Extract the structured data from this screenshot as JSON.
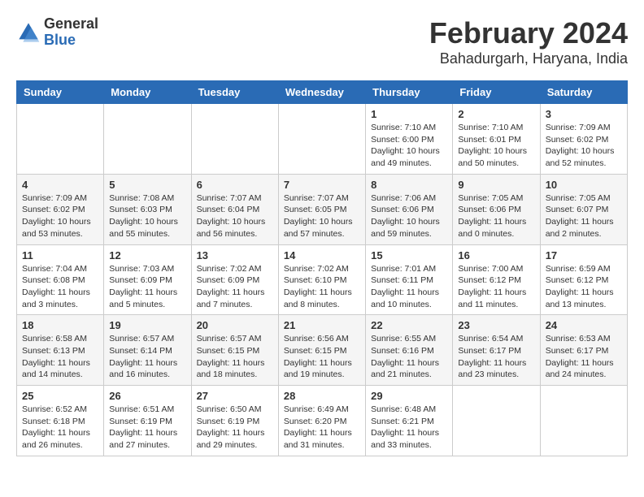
{
  "header": {
    "logo": {
      "line1": "General",
      "line2": "Blue"
    },
    "title": "February 2024",
    "location": "Bahadurgarh, Haryana, India"
  },
  "weekdays": [
    "Sunday",
    "Monday",
    "Tuesday",
    "Wednesday",
    "Thursday",
    "Friday",
    "Saturday"
  ],
  "weeks": [
    [
      {
        "day": "",
        "info": ""
      },
      {
        "day": "",
        "info": ""
      },
      {
        "day": "",
        "info": ""
      },
      {
        "day": "",
        "info": ""
      },
      {
        "day": "1",
        "info": "Sunrise: 7:10 AM\nSunset: 6:00 PM\nDaylight: 10 hours\nand 49 minutes."
      },
      {
        "day": "2",
        "info": "Sunrise: 7:10 AM\nSunset: 6:01 PM\nDaylight: 10 hours\nand 50 minutes."
      },
      {
        "day": "3",
        "info": "Sunrise: 7:09 AM\nSunset: 6:02 PM\nDaylight: 10 hours\nand 52 minutes."
      }
    ],
    [
      {
        "day": "4",
        "info": "Sunrise: 7:09 AM\nSunset: 6:02 PM\nDaylight: 10 hours\nand 53 minutes."
      },
      {
        "day": "5",
        "info": "Sunrise: 7:08 AM\nSunset: 6:03 PM\nDaylight: 10 hours\nand 55 minutes."
      },
      {
        "day": "6",
        "info": "Sunrise: 7:07 AM\nSunset: 6:04 PM\nDaylight: 10 hours\nand 56 minutes."
      },
      {
        "day": "7",
        "info": "Sunrise: 7:07 AM\nSunset: 6:05 PM\nDaylight: 10 hours\nand 57 minutes."
      },
      {
        "day": "8",
        "info": "Sunrise: 7:06 AM\nSunset: 6:06 PM\nDaylight: 10 hours\nand 59 minutes."
      },
      {
        "day": "9",
        "info": "Sunrise: 7:05 AM\nSunset: 6:06 PM\nDaylight: 11 hours\nand 0 minutes."
      },
      {
        "day": "10",
        "info": "Sunrise: 7:05 AM\nSunset: 6:07 PM\nDaylight: 11 hours\nand 2 minutes."
      }
    ],
    [
      {
        "day": "11",
        "info": "Sunrise: 7:04 AM\nSunset: 6:08 PM\nDaylight: 11 hours\nand 3 minutes."
      },
      {
        "day": "12",
        "info": "Sunrise: 7:03 AM\nSunset: 6:09 PM\nDaylight: 11 hours\nand 5 minutes."
      },
      {
        "day": "13",
        "info": "Sunrise: 7:02 AM\nSunset: 6:09 PM\nDaylight: 11 hours\nand 7 minutes."
      },
      {
        "day": "14",
        "info": "Sunrise: 7:02 AM\nSunset: 6:10 PM\nDaylight: 11 hours\nand 8 minutes."
      },
      {
        "day": "15",
        "info": "Sunrise: 7:01 AM\nSunset: 6:11 PM\nDaylight: 11 hours\nand 10 minutes."
      },
      {
        "day": "16",
        "info": "Sunrise: 7:00 AM\nSunset: 6:12 PM\nDaylight: 11 hours\nand 11 minutes."
      },
      {
        "day": "17",
        "info": "Sunrise: 6:59 AM\nSunset: 6:12 PM\nDaylight: 11 hours\nand 13 minutes."
      }
    ],
    [
      {
        "day": "18",
        "info": "Sunrise: 6:58 AM\nSunset: 6:13 PM\nDaylight: 11 hours\nand 14 minutes."
      },
      {
        "day": "19",
        "info": "Sunrise: 6:57 AM\nSunset: 6:14 PM\nDaylight: 11 hours\nand 16 minutes."
      },
      {
        "day": "20",
        "info": "Sunrise: 6:57 AM\nSunset: 6:15 PM\nDaylight: 11 hours\nand 18 minutes."
      },
      {
        "day": "21",
        "info": "Sunrise: 6:56 AM\nSunset: 6:15 PM\nDaylight: 11 hours\nand 19 minutes."
      },
      {
        "day": "22",
        "info": "Sunrise: 6:55 AM\nSunset: 6:16 PM\nDaylight: 11 hours\nand 21 minutes."
      },
      {
        "day": "23",
        "info": "Sunrise: 6:54 AM\nSunset: 6:17 PM\nDaylight: 11 hours\nand 23 minutes."
      },
      {
        "day": "24",
        "info": "Sunrise: 6:53 AM\nSunset: 6:17 PM\nDaylight: 11 hours\nand 24 minutes."
      }
    ],
    [
      {
        "day": "25",
        "info": "Sunrise: 6:52 AM\nSunset: 6:18 PM\nDaylight: 11 hours\nand 26 minutes."
      },
      {
        "day": "26",
        "info": "Sunrise: 6:51 AM\nSunset: 6:19 PM\nDaylight: 11 hours\nand 27 minutes."
      },
      {
        "day": "27",
        "info": "Sunrise: 6:50 AM\nSunset: 6:19 PM\nDaylight: 11 hours\nand 29 minutes."
      },
      {
        "day": "28",
        "info": "Sunrise: 6:49 AM\nSunset: 6:20 PM\nDaylight: 11 hours\nand 31 minutes."
      },
      {
        "day": "29",
        "info": "Sunrise: 6:48 AM\nSunset: 6:21 PM\nDaylight: 11 hours\nand 33 minutes."
      },
      {
        "day": "",
        "info": ""
      },
      {
        "day": "",
        "info": ""
      }
    ]
  ]
}
